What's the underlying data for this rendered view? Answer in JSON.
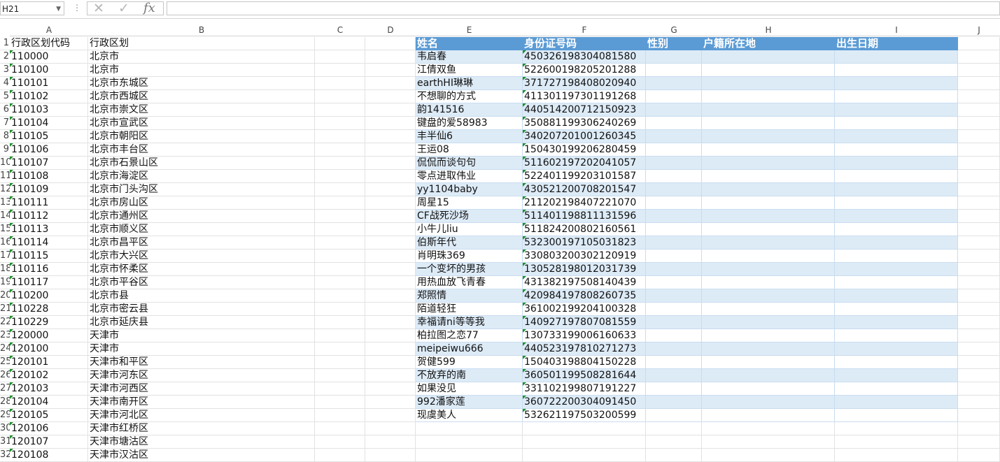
{
  "formula_bar": {
    "name_box": "H21",
    "cancel_icon": "✕",
    "confirm_icon": "✓",
    "fx_label": "fx",
    "formula": ""
  },
  "columns": [
    "A",
    "B",
    "C",
    "D",
    "E",
    "F",
    "G",
    "H",
    "I",
    "J"
  ],
  "row_numbers": [
    "1",
    "2",
    "3",
    "4",
    "5",
    "6",
    "7",
    "8",
    "9",
    "10",
    "11",
    "12",
    "13",
    "14",
    "15",
    "16",
    "17",
    "18",
    "19",
    "20",
    "21",
    "22",
    "23",
    "24",
    "25",
    "26",
    "27",
    "28",
    "29",
    "30",
    "31",
    "32"
  ],
  "left_table": {
    "headers": [
      "行政区划代码",
      "行政区划"
    ],
    "rows": [
      [
        "110000",
        "北京市"
      ],
      [
        "110100",
        "北京市"
      ],
      [
        "110101",
        "北京市东城区"
      ],
      [
        "110102",
        "北京市西城区"
      ],
      [
        "110103",
        "北京市崇文区"
      ],
      [
        "110104",
        "北京市宣武区"
      ],
      [
        "110105",
        "北京市朝阳区"
      ],
      [
        "110106",
        "北京市丰台区"
      ],
      [
        "110107",
        "北京市石景山区"
      ],
      [
        "110108",
        "北京市海淀区"
      ],
      [
        "110109",
        "北京市门头沟区"
      ],
      [
        "110111",
        "北京市房山区"
      ],
      [
        "110112",
        "北京市通州区"
      ],
      [
        "110113",
        "北京市顺义区"
      ],
      [
        "110114",
        "北京市昌平区"
      ],
      [
        "110115",
        "北京市大兴区"
      ],
      [
        "110116",
        "北京市怀柔区"
      ],
      [
        "110117",
        "北京市平谷区"
      ],
      [
        "110200",
        "北京市县"
      ],
      [
        "110228",
        "北京市密云县"
      ],
      [
        "110229",
        "北京市延庆县"
      ],
      [
        "120000",
        "天津市"
      ],
      [
        "120100",
        "天津市"
      ],
      [
        "120101",
        "天津市和平区"
      ],
      [
        "120102",
        "天津市河东区"
      ],
      [
        "120103",
        "天津市河西区"
      ],
      [
        "120104",
        "天津市南开区"
      ],
      [
        "120105",
        "天津市河北区"
      ],
      [
        "120106",
        "天津市红桥区"
      ],
      [
        "120107",
        "天津市塘沽区"
      ],
      [
        "120108",
        "天津市汉沽区"
      ]
    ]
  },
  "right_table": {
    "headers": [
      "姓名",
      "身份证号码",
      "性别",
      "户籍所在地",
      "出生日期"
    ],
    "rows": [
      [
        "韦启春",
        "450326198304081580"
      ],
      [
        "江倩双鱼",
        "522600198205201288"
      ],
      [
        "earthHI琳琳",
        "371727198408020940"
      ],
      [
        "不想聊的方式",
        "411301197301191268"
      ],
      [
        "韵141516",
        "440514200712150923"
      ],
      [
        "键盘的爱58983",
        "350881199306240269"
      ],
      [
        "丰半仙6",
        "340207201001260345"
      ],
      [
        "王运08",
        "150430199206280459"
      ],
      [
        "侃侃而谈句句",
        "511602197202041057"
      ],
      [
        "零点进取伟业",
        "522401199203101587"
      ],
      [
        "yy1104baby",
        "430521200708201547"
      ],
      [
        "周星15",
        "211202198407221070"
      ],
      [
        "CF战死沙场",
        "511401198811131596"
      ],
      [
        "小牛儿liu",
        "511824200802160561"
      ],
      [
        "伯斯年代",
        "532300197105031823"
      ],
      [
        "肖明珠369",
        "330803200302120919"
      ],
      [
        "一个变坏的男孩",
        "130528198012031739"
      ],
      [
        "用热血放飞青春",
        "431382197508140439"
      ],
      [
        "郑照情",
        "420984197808260735"
      ],
      [
        "陌道轻狂",
        "361002199204100328"
      ],
      [
        "幸福请ni等等我",
        "140927197807081559"
      ],
      [
        "柏拉图之恋77",
        "130733199006160633"
      ],
      [
        "meipeiwu666",
        "440523197810271273"
      ],
      [
        "贺健599",
        "150403198804150228"
      ],
      [
        "不放弃的南",
        "360501199508281644"
      ],
      [
        "如果没见",
        "331102199807191227"
      ],
      [
        "992潘家莲",
        "360722200304091450"
      ],
      [
        "现虞美人",
        "532621197503200599"
      ]
    ]
  },
  "colors": {
    "header_blue": "#5b9bd5",
    "band_blue": "#ddebf7",
    "indicator_green": "#1a8f2c"
  }
}
